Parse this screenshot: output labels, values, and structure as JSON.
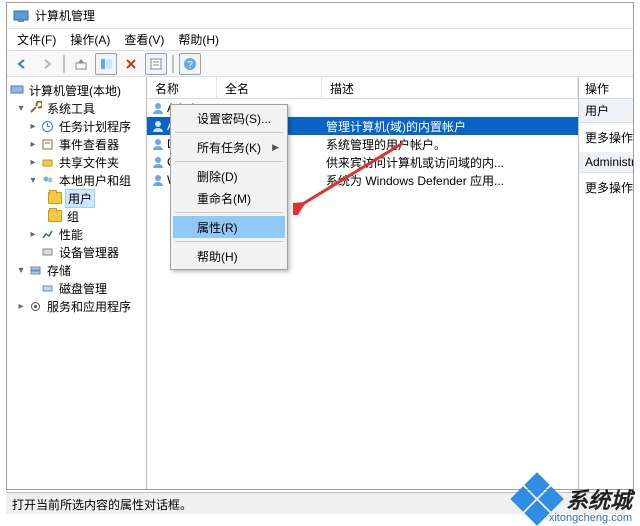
{
  "window": {
    "title": "计算机管理"
  },
  "menubar": {
    "file": "文件(F)",
    "action": "操作(A)",
    "view": "查看(V)",
    "help": "帮助(H)"
  },
  "tree": {
    "root": "计算机管理(本地)",
    "systools": "系统工具",
    "sched": "任务计划程序",
    "event": "事件查看器",
    "share": "共享文件夹",
    "localusers": "本地用户和组",
    "users": "用户",
    "groups": "组",
    "perf": "性能",
    "devmgr": "设备管理器",
    "storage": "存储",
    "diskmgr": "磁盘管理",
    "services": "服务和应用程序"
  },
  "columns": {
    "name": "名称",
    "full": "全名",
    "desc": "描述"
  },
  "rows": [
    {
      "name": "Admin",
      "full": "",
      "desc": ""
    },
    {
      "name": "Administrat",
      "full": "",
      "desc": "管理计算机(域)的内置帐户"
    },
    {
      "name": "De",
      "full": "",
      "desc": "系统管理的用户帐户。"
    },
    {
      "name": "Gu",
      "full": "",
      "desc": "供来宾访问计算机或访问域的内..."
    },
    {
      "name": "W",
      "full": "",
      "desc": "系统为 Windows Defender 应用..."
    }
  ],
  "context": {
    "setpw": "设置密码(S)...",
    "alltasks": "所有任务(K)",
    "delete": "删除(D)",
    "rename": "重命名(M)",
    "props": "属性(R)",
    "help": "帮助(H)"
  },
  "actions": {
    "header": "操作",
    "sec1": "用户",
    "more1": "更多操作",
    "sec2": "Administrat",
    "more2": "更多操作"
  },
  "status": "打开当前所选内容的属性对话框。",
  "watermark": {
    "brand": "系统城",
    "url": "xitongcheng.com"
  }
}
